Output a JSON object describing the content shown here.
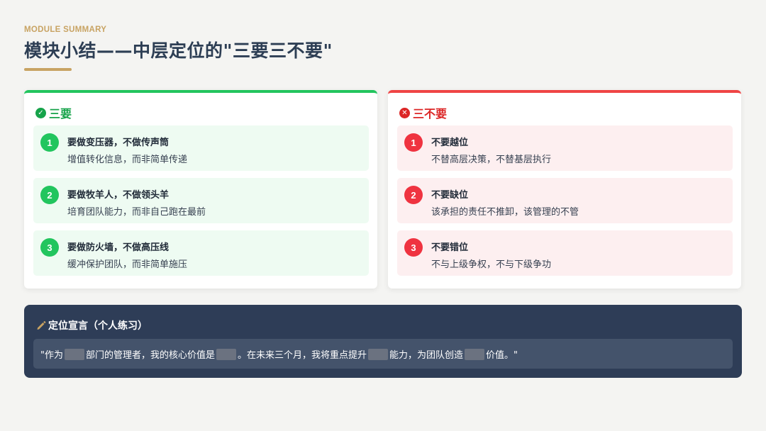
{
  "header": {
    "kicker": "MODULE SUMMARY",
    "title": "模块小结——中层定位的\"三要三不要\""
  },
  "do": {
    "label": "三要",
    "icon": "check-circle-icon",
    "items": [
      {
        "num": "1",
        "title": "要做变压器，不做传声筒",
        "desc": "增值转化信息，而非简单传递"
      },
      {
        "num": "2",
        "title": "要做牧羊人，不做领头羊",
        "desc": "培育团队能力，而非自己跑在最前"
      },
      {
        "num": "3",
        "title": "要做防火墙，不做高压线",
        "desc": "缓冲保护团队，而非简单施压"
      }
    ]
  },
  "dont": {
    "label": "三不要",
    "icon": "x-circle-icon",
    "items": [
      {
        "num": "1",
        "title": "不要越位",
        "desc": "不替高层决策，不替基层执行"
      },
      {
        "num": "2",
        "title": "不要缺位",
        "desc": "该承担的责任不推卸，该管理的不管"
      },
      {
        "num": "3",
        "title": "不要错位",
        "desc": "不与上级争权，不与下级争功"
      }
    ]
  },
  "declaration": {
    "icon": "pencil-icon",
    "title": "定位宣言（个人练习）",
    "seg1": "\"作为",
    "seg2": "部门的管理者，我的核心价值是",
    "seg3": "。在未来三个月，我将重点提升",
    "seg4": "能力，为团队创造",
    "seg5": "价值。\""
  },
  "colors": {
    "accent_gold": "#c8a363",
    "do_green": "#22c55e",
    "dont_red": "#ef4444",
    "navy": "#2e3d57"
  }
}
